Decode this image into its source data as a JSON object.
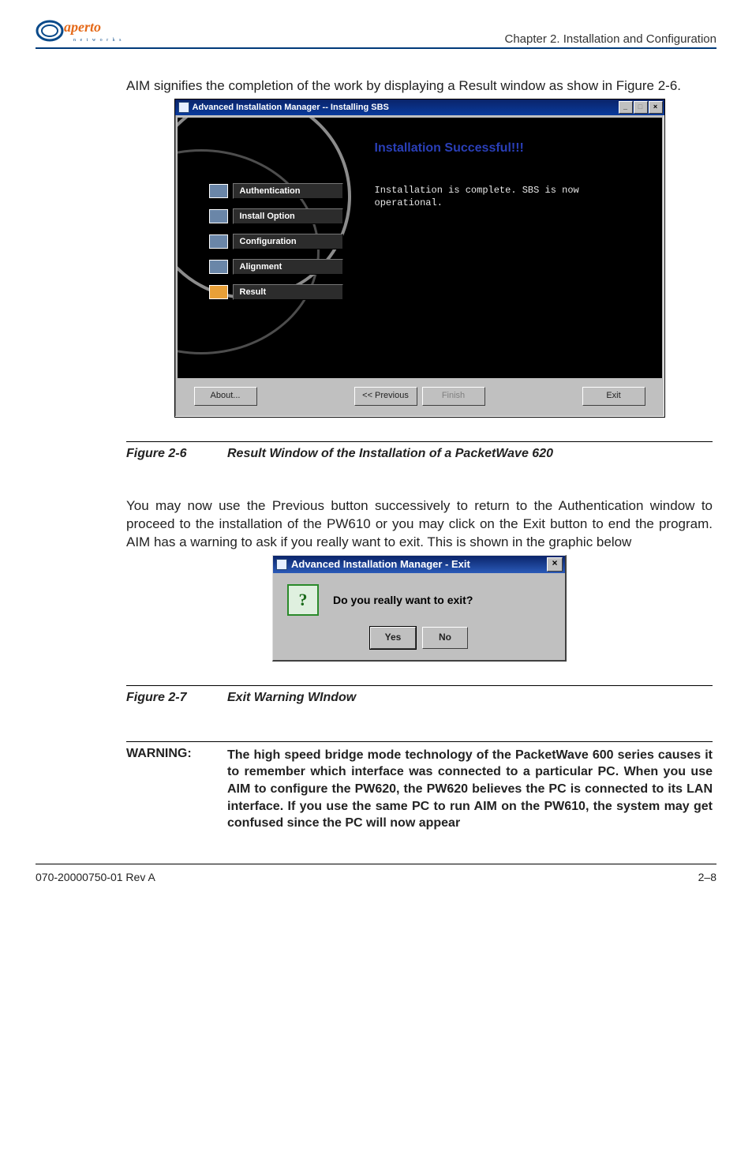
{
  "header": {
    "logo_main": "aperto",
    "logo_sub": "n e t w o r k s",
    "chapter": "Chapter 2.  Installation and Configuration"
  },
  "body": {
    "para1": "AIM signifies the completion of the work by displaying a Result window as show in Figure 2-6.",
    "para2": "You may now use the Previous button successively to return to the Authentication window to proceed to the installation of the PW610 or you may click on the Exit button to end the program. AIM has a warning to ask if you really want to exit. This is shown in the graphic below"
  },
  "win1": {
    "title": "Advanced Installation Manager -- Installing SBS",
    "ctrl_min": "_",
    "ctrl_max": "□",
    "ctrl_close": "×",
    "steps": [
      {
        "label": "Authentication",
        "state": "done"
      },
      {
        "label": "Install Option",
        "state": "done"
      },
      {
        "label": "Configuration",
        "state": "done"
      },
      {
        "label": "Alignment",
        "state": "done"
      },
      {
        "label": "Result",
        "state": "active"
      }
    ],
    "headline": "Installation Successful!!!",
    "message": "Installation is complete. SBS is now\noperational.",
    "btn_about": "About...",
    "btn_prev": "<< Previous",
    "btn_finish": "Finish",
    "btn_exit": "Exit"
  },
  "fig1": {
    "num": "Figure 2-6",
    "cap": "Result Window of the Installation of a PacketWave 620"
  },
  "win2": {
    "title": "Advanced Installation Manager - Exit",
    "ctrl_close": "×",
    "question_glyph": "?",
    "message": "Do you really want to exit?",
    "btn_yes": "Yes",
    "btn_no": "No"
  },
  "fig2": {
    "num": "Figure 2-7",
    "cap": "Exit Warning WIndow"
  },
  "warning": {
    "label": "WARNING:",
    "text": "The high speed bridge mode technology of the PacketWave 600 series causes it to remember which interface was connected to a particular PC. When you use AIM to configure the PW620, the PW620 believes the PC is connected to its LAN interface. If you use the same PC to run AIM on the PW610, the system may get confused since the PC will now appear"
  },
  "footer": {
    "left": "070-20000750-01 Rev A",
    "right": "2–8"
  }
}
